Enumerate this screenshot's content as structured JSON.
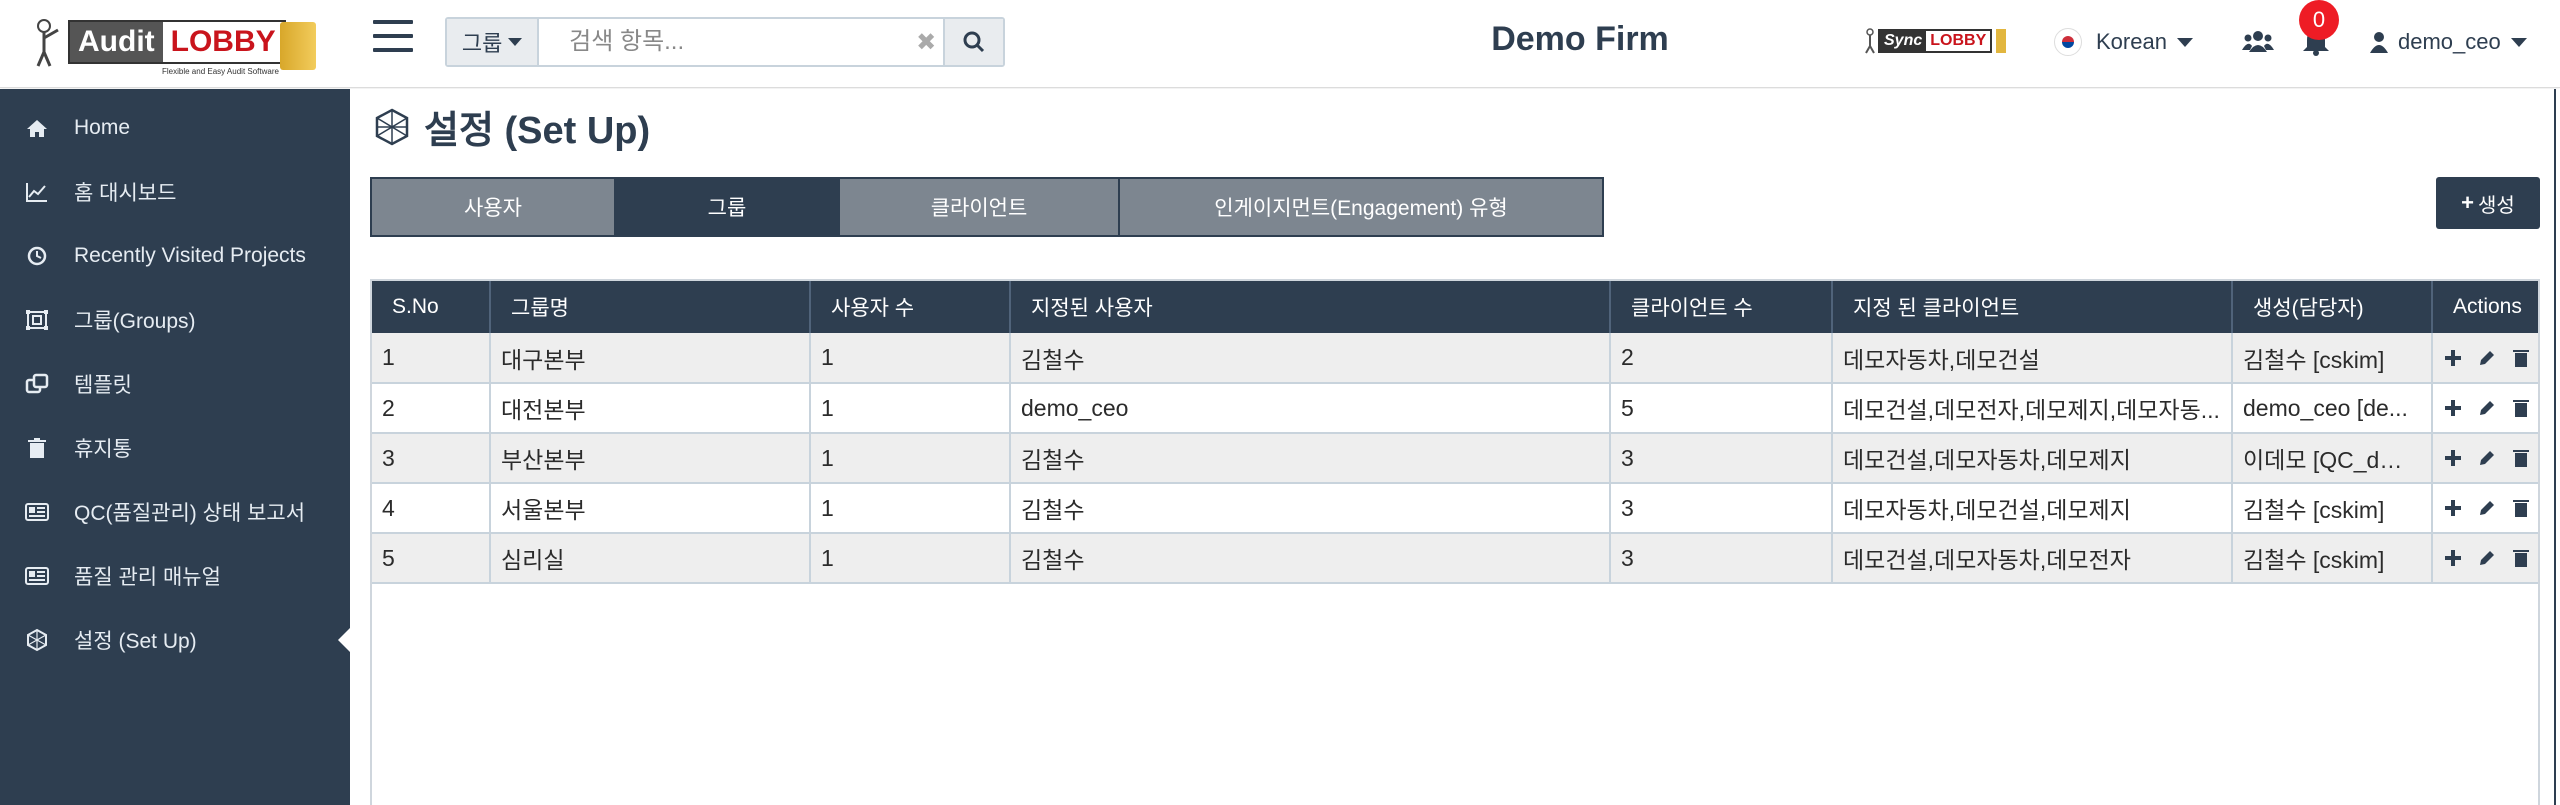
{
  "header": {
    "logo": {
      "part1": "Audit",
      "part2": "LOBBY",
      "tagline": "Flexible and Easy Audit Software"
    },
    "search": {
      "dropdown_label": "그룹",
      "placeholder": "검색 항목..."
    },
    "firm_name": "Demo Firm",
    "sync_logo": {
      "part1": "Sync",
      "part2": "LOBBY"
    },
    "language": {
      "label": "Korean"
    },
    "notifications": {
      "count": "0"
    },
    "user": {
      "name": "demo_ceo"
    }
  },
  "sidebar": {
    "items": [
      {
        "label": "Home",
        "icon": "home-icon"
      },
      {
        "label": "홈 대시보드",
        "icon": "line-chart-icon"
      },
      {
        "label": "Recently Visited Projects",
        "icon": "clock-icon"
      },
      {
        "label": "그룹(Groups)",
        "icon": "group-icon"
      },
      {
        "label": "템플릿",
        "icon": "template-icon"
      },
      {
        "label": "휴지통",
        "icon": "trash-icon"
      },
      {
        "label": "QC(품질관리) 상태 보고서",
        "icon": "report-icon"
      },
      {
        "label": "품질 관리 매뉴얼",
        "icon": "manual-icon"
      },
      {
        "label": "설정 (Set Up)",
        "icon": "setup-icon",
        "active": true
      }
    ]
  },
  "page": {
    "title": "설정 (Set Up)",
    "tabs": [
      {
        "label": "사용자"
      },
      {
        "label": "그룹",
        "active": true
      },
      {
        "label": "클라이언트"
      },
      {
        "label": "인게이지먼트(Engagement) 유형"
      }
    ],
    "create_button": "생성"
  },
  "table": {
    "columns": [
      "S.No",
      "그룹명",
      "사용자 수",
      "지정된 사용자",
      "클라이언트 수",
      "지정 된 클라이언트",
      "생성(담당자)",
      "Actions"
    ],
    "rows": [
      [
        "1",
        "대구본부",
        "1",
        "김철수",
        "2",
        "데모자동차,데모건설",
        "김철수 [cskim]"
      ],
      [
        "2",
        "대전본부",
        "1",
        "demo_ceo",
        "5",
        "데모건설,데모전자,데모제지,데모자동...",
        "demo_ceo [de..."
      ],
      [
        "3",
        "부산본부",
        "1",
        "김철수",
        "3",
        "데모건설,데모자동차,데모제지",
        "이데모 [QC_dml..."
      ],
      [
        "4",
        "서울본부",
        "1",
        "김철수",
        "3",
        "데모자동차,데모건설,데모제지",
        "김철수 [cskim]"
      ],
      [
        "5",
        "심리실",
        "1",
        "김철수",
        "3",
        "데모건설,데모자동차,데모전자",
        "김철수 [cskim]"
      ]
    ]
  },
  "colors": {
    "primary": "#2e3e50",
    "tab_inactive": "#7d8690",
    "badge_red": "#ee1c25",
    "logo_red": "#c9141c"
  }
}
